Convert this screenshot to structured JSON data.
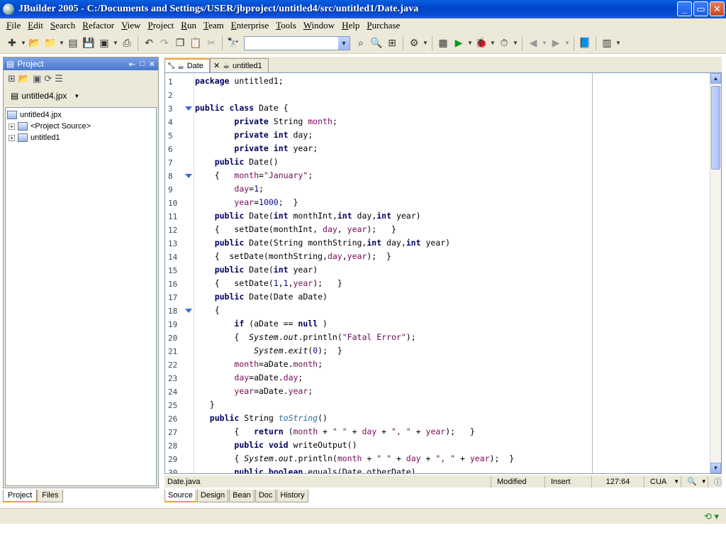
{
  "window": {
    "title": "JBuilder 2005 - C:/Documents and Settings/USER/jbproject/untitled4/src/untitled1/Date.java",
    "controls": {
      "minimize": "_",
      "maximize": "▭",
      "close": "✕"
    }
  },
  "menu": [
    "File",
    "Edit",
    "Search",
    "Refactor",
    "View",
    "Project",
    "Run",
    "Team",
    "Enterprise",
    "Tools",
    "Window",
    "Help",
    "Purchase"
  ],
  "toolbar": {
    "search_value": "",
    "icons": [
      "new-icon",
      "open-icon",
      "reopen-icon",
      "save-icon",
      "save-all-icon",
      "print-icon",
      "undo-icon",
      "redo-icon",
      "copy-icon",
      "paste-icon",
      "cut-icon",
      "find-icon",
      "make-icon",
      "run-icon",
      "debug-icon",
      "back-icon",
      "forward-icon",
      "help-icon"
    ]
  },
  "project_panel": {
    "title": "Project",
    "project_file": "untitled4.jpx",
    "tree": [
      {
        "label": "untitled4.jpx",
        "level": 0,
        "expandable": false
      },
      {
        "label": "<Project Source>",
        "level": 1,
        "expandable": true
      },
      {
        "label": "untitled1",
        "level": 1,
        "expandable": true
      }
    ],
    "tabs": [
      "Project",
      "Files"
    ]
  },
  "editor": {
    "tabs": [
      {
        "label": "Date",
        "active": true
      },
      {
        "label": "untitled1",
        "active": false
      }
    ],
    "lines": [
      "package untitled1;",
      "",
      "public class Date {",
      "        private String month;",
      "        private int day;",
      "        private int year;",
      "    public Date()",
      "    {   month=\"January\";",
      "        day=1;",
      "        year=1000;  }",
      "    public Date(int monthInt,int day,int year)",
      "    {   setDate(monthInt, day, year);   }",
      "    public Date(String monthString,int day,int year)",
      "    {  setDate(monthString,day,year);  }",
      "    public Date(int year)",
      "    {   setDate(1,1,year);   }",
      "    public Date(Date aDate)",
      "    {",
      "        if (aDate == null )",
      "        {  System.out.println(\"Fatal Error\");",
      "            System.exit(0);  }",
      "        month=aDate.month;",
      "        day=aDate.day;",
      "        year=aDate.year;",
      "   }",
      "   public String toString()",
      "        {   return (month + \" \" + day + \", \" + year);   }",
      "        public void writeOutput()",
      "        { System.out.println(month + \" \" + day + \", \" + year);  }",
      "        public boolean equals(Date otherDate)"
    ],
    "fold_lines": [
      3,
      8,
      18
    ],
    "status": {
      "file": "Date.java",
      "modified": "Modified",
      "mode": "Insert",
      "position": "127:64",
      "keymap": "CUA"
    },
    "bottom_tabs": [
      "Source",
      "Design",
      "Bean",
      "Doc",
      "History"
    ]
  }
}
